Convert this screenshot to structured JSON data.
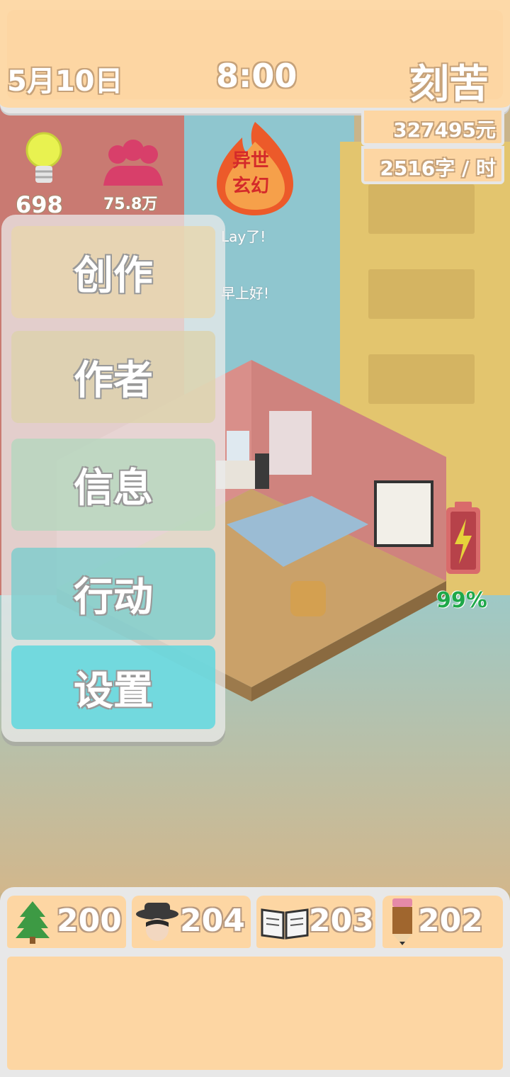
{
  "header": {
    "date": "5月10日",
    "time": "8:00",
    "mood": "刻苦",
    "money": "327495元",
    "speed": "2516字 / 时"
  },
  "stats": {
    "ideas": "698",
    "fans": "75.8万",
    "genre_line1": "异世",
    "genre_line2": "玄幻"
  },
  "messages": {
    "msg1": "Lay了!",
    "msg2": "早上好!"
  },
  "menu": {
    "items": [
      "创作",
      "作者",
      "信息",
      "行动",
      "设置"
    ]
  },
  "battery": {
    "percent_label": "99%",
    "level": 0.99
  },
  "resources": {
    "tree": "200",
    "hat": "204",
    "book": "203",
    "pencil": "202"
  },
  "icons": [
    "lightbulb-icon",
    "fans-icon",
    "fire-genre-icon",
    "battery-icon",
    "tree-icon",
    "detective-icon",
    "book-icon",
    "pencil-icon"
  ]
}
